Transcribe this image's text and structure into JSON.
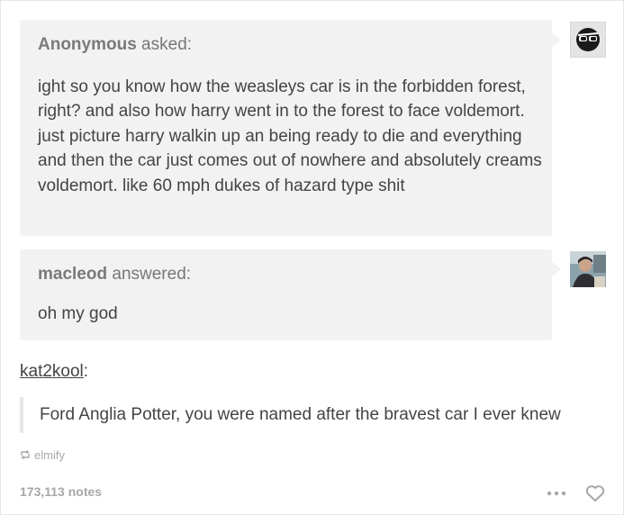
{
  "question": {
    "asker_name": "Anonymous",
    "asker_suffix": " asked:",
    "text": "ight so you know how the weasleys car is in the forbidden forest, right? and also how harry went in to the forest to face voldemort. just picture harry walkin up an being ready to die and everything and then the car just comes out of nowhere and absolutely creams voldemort. like 60 mph dukes of hazard type shit"
  },
  "answer": {
    "answerer_name": "macleod",
    "answerer_suffix": " answered:",
    "text": "oh my god"
  },
  "reblog": {
    "username": "kat2kool",
    "suffix": ":",
    "quote": "Ford Anglia Potter, you were named after the bravest car I ever knew"
  },
  "source": {
    "icon": "reblog-icon",
    "name": "elmify"
  },
  "footer": {
    "notes": "173,113 notes",
    "more_icon": "ellipsis-icon",
    "like_icon": "heart-icon"
  },
  "icons": {
    "anonymous_avatar": "sunglasses-anon-icon",
    "macleod_avatar": "photo-avatar"
  }
}
